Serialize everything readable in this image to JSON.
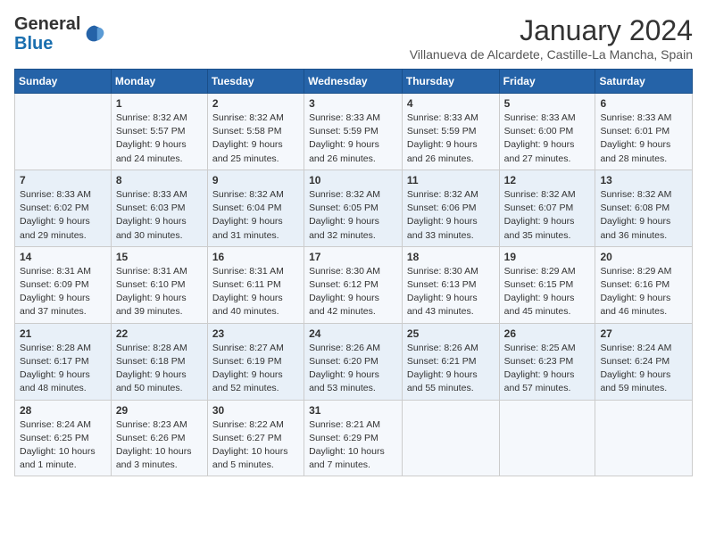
{
  "header": {
    "logo_general": "General",
    "logo_blue": "Blue",
    "month_title": "January 2024",
    "subtitle": "Villanueva de Alcardete, Castille-La Mancha, Spain"
  },
  "weekdays": [
    "Sunday",
    "Monday",
    "Tuesday",
    "Wednesday",
    "Thursday",
    "Friday",
    "Saturday"
  ],
  "weeks": [
    [
      {
        "day": "",
        "info": ""
      },
      {
        "day": "1",
        "info": "Sunrise: 8:32 AM\nSunset: 5:57 PM\nDaylight: 9 hours\nand 24 minutes."
      },
      {
        "day": "2",
        "info": "Sunrise: 8:32 AM\nSunset: 5:58 PM\nDaylight: 9 hours\nand 25 minutes."
      },
      {
        "day": "3",
        "info": "Sunrise: 8:33 AM\nSunset: 5:59 PM\nDaylight: 9 hours\nand 26 minutes."
      },
      {
        "day": "4",
        "info": "Sunrise: 8:33 AM\nSunset: 5:59 PM\nDaylight: 9 hours\nand 26 minutes."
      },
      {
        "day": "5",
        "info": "Sunrise: 8:33 AM\nSunset: 6:00 PM\nDaylight: 9 hours\nand 27 minutes."
      },
      {
        "day": "6",
        "info": "Sunrise: 8:33 AM\nSunset: 6:01 PM\nDaylight: 9 hours\nand 28 minutes."
      }
    ],
    [
      {
        "day": "7",
        "info": "Sunrise: 8:33 AM\nSunset: 6:02 PM\nDaylight: 9 hours\nand 29 minutes."
      },
      {
        "day": "8",
        "info": "Sunrise: 8:33 AM\nSunset: 6:03 PM\nDaylight: 9 hours\nand 30 minutes."
      },
      {
        "day": "9",
        "info": "Sunrise: 8:32 AM\nSunset: 6:04 PM\nDaylight: 9 hours\nand 31 minutes."
      },
      {
        "day": "10",
        "info": "Sunrise: 8:32 AM\nSunset: 6:05 PM\nDaylight: 9 hours\nand 32 minutes."
      },
      {
        "day": "11",
        "info": "Sunrise: 8:32 AM\nSunset: 6:06 PM\nDaylight: 9 hours\nand 33 minutes."
      },
      {
        "day": "12",
        "info": "Sunrise: 8:32 AM\nSunset: 6:07 PM\nDaylight: 9 hours\nand 35 minutes."
      },
      {
        "day": "13",
        "info": "Sunrise: 8:32 AM\nSunset: 6:08 PM\nDaylight: 9 hours\nand 36 minutes."
      }
    ],
    [
      {
        "day": "14",
        "info": "Sunrise: 8:31 AM\nSunset: 6:09 PM\nDaylight: 9 hours\nand 37 minutes."
      },
      {
        "day": "15",
        "info": "Sunrise: 8:31 AM\nSunset: 6:10 PM\nDaylight: 9 hours\nand 39 minutes."
      },
      {
        "day": "16",
        "info": "Sunrise: 8:31 AM\nSunset: 6:11 PM\nDaylight: 9 hours\nand 40 minutes."
      },
      {
        "day": "17",
        "info": "Sunrise: 8:30 AM\nSunset: 6:12 PM\nDaylight: 9 hours\nand 42 minutes."
      },
      {
        "day": "18",
        "info": "Sunrise: 8:30 AM\nSunset: 6:13 PM\nDaylight: 9 hours\nand 43 minutes."
      },
      {
        "day": "19",
        "info": "Sunrise: 8:29 AM\nSunset: 6:15 PM\nDaylight: 9 hours\nand 45 minutes."
      },
      {
        "day": "20",
        "info": "Sunrise: 8:29 AM\nSunset: 6:16 PM\nDaylight: 9 hours\nand 46 minutes."
      }
    ],
    [
      {
        "day": "21",
        "info": "Sunrise: 8:28 AM\nSunset: 6:17 PM\nDaylight: 9 hours\nand 48 minutes."
      },
      {
        "day": "22",
        "info": "Sunrise: 8:28 AM\nSunset: 6:18 PM\nDaylight: 9 hours\nand 50 minutes."
      },
      {
        "day": "23",
        "info": "Sunrise: 8:27 AM\nSunset: 6:19 PM\nDaylight: 9 hours\nand 52 minutes."
      },
      {
        "day": "24",
        "info": "Sunrise: 8:26 AM\nSunset: 6:20 PM\nDaylight: 9 hours\nand 53 minutes."
      },
      {
        "day": "25",
        "info": "Sunrise: 8:26 AM\nSunset: 6:21 PM\nDaylight: 9 hours\nand 55 minutes."
      },
      {
        "day": "26",
        "info": "Sunrise: 8:25 AM\nSunset: 6:23 PM\nDaylight: 9 hours\nand 57 minutes."
      },
      {
        "day": "27",
        "info": "Sunrise: 8:24 AM\nSunset: 6:24 PM\nDaylight: 9 hours\nand 59 minutes."
      }
    ],
    [
      {
        "day": "28",
        "info": "Sunrise: 8:24 AM\nSunset: 6:25 PM\nDaylight: 10 hours\nand 1 minute."
      },
      {
        "day": "29",
        "info": "Sunrise: 8:23 AM\nSunset: 6:26 PM\nDaylight: 10 hours\nand 3 minutes."
      },
      {
        "day": "30",
        "info": "Sunrise: 8:22 AM\nSunset: 6:27 PM\nDaylight: 10 hours\nand 5 minutes."
      },
      {
        "day": "31",
        "info": "Sunrise: 8:21 AM\nSunset: 6:29 PM\nDaylight: 10 hours\nand 7 minutes."
      },
      {
        "day": "",
        "info": ""
      },
      {
        "day": "",
        "info": ""
      },
      {
        "day": "",
        "info": ""
      }
    ]
  ]
}
